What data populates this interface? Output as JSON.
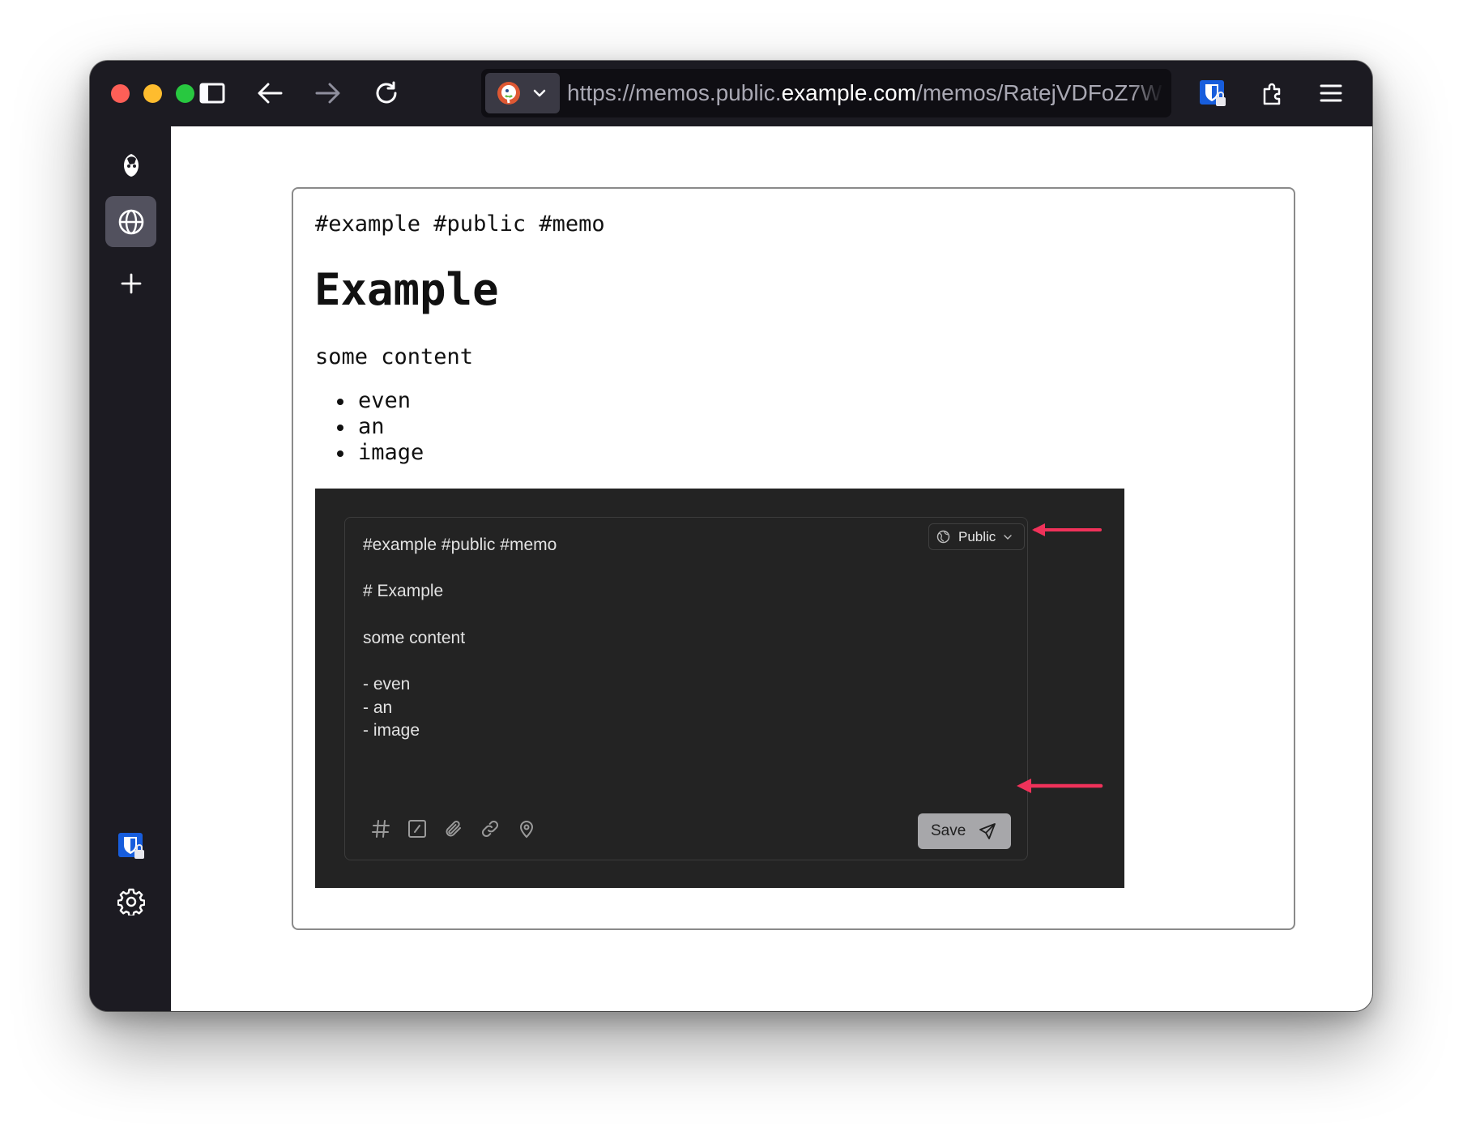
{
  "browser": {
    "url_prefix": "https://memos.public.",
    "url_host": "example.com",
    "url_suffix": "/memos/RatejVDFoZ7W",
    "colors": {
      "chrome": "#1c1b22",
      "urlbar": "#0f0e13",
      "accent_arrow": "#f0325a"
    }
  },
  "memo": {
    "tags": "#example #public #memo",
    "heading": "Example",
    "paragraph": "some content",
    "list": [
      "even",
      "an",
      "image"
    ]
  },
  "embedded_editor": {
    "visibility": "Public",
    "lines": [
      "#example #public #memo",
      "# Example",
      "some content",
      "- even",
      "- an",
      "- image"
    ],
    "save_label": "Save",
    "toolbar_icons": [
      "hash-icon",
      "slash-box-icon",
      "paperclip-icon",
      "link-icon",
      "map-pin-icon"
    ]
  }
}
